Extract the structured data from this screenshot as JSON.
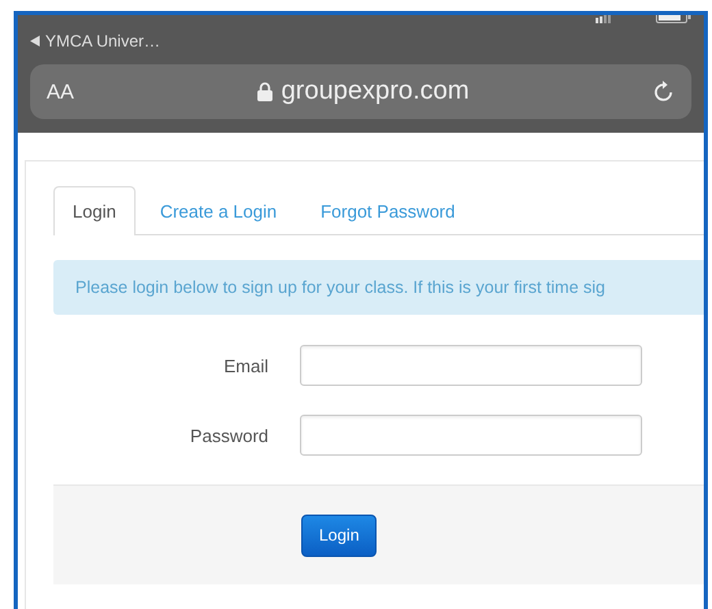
{
  "status_bar": {
    "back_label": "YMCA Univer…"
  },
  "address_bar": {
    "text_size": "AA",
    "url": "groupexpro.com"
  },
  "tabs": [
    {
      "label": "Login",
      "selected": true
    },
    {
      "label": "Create a Login",
      "selected": false
    },
    {
      "label": "Forgot Password",
      "selected": false
    }
  ],
  "alert": "Please login below to sign up for your class. If this is your first time sig",
  "fields": [
    {
      "label": "Email"
    },
    {
      "label": "Password"
    }
  ],
  "submit": "Login"
}
